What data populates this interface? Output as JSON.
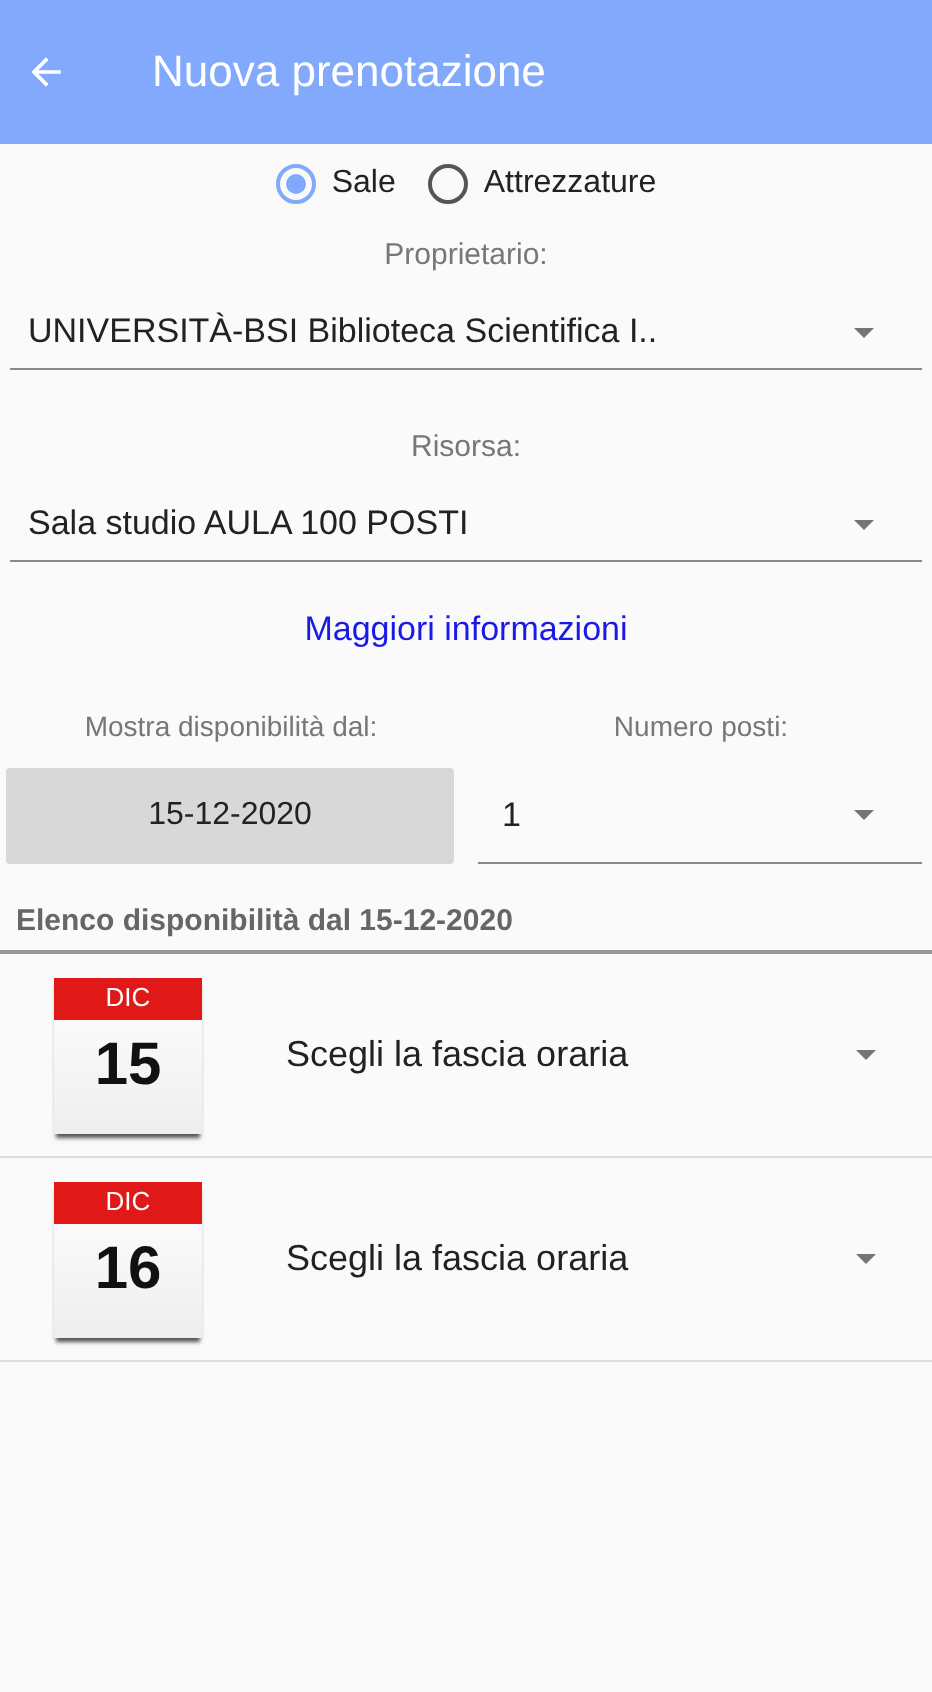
{
  "app_bar": {
    "title": "Nuova prenotazione"
  },
  "resource_type": [
    {
      "label": "Sale",
      "selected": true
    },
    {
      "label": "Attrezzature",
      "selected": false
    }
  ],
  "owner": {
    "label": "Proprietario:",
    "value": "UNIVERSITÀ-BSI Biblioteca Scientifica I.."
  },
  "resource": {
    "label": "Risorsa:",
    "value": "Sala studio AULA 100 POSTI"
  },
  "more_info_link": "Maggiori informazioni",
  "start_date": {
    "label": "Mostra disponibilità dal:",
    "value": "15-12-2020"
  },
  "seats": {
    "label": "Numero posti:",
    "value": "1"
  },
  "availability": {
    "heading": "Elenco disponibilità dal 15-12-2020",
    "days": [
      {
        "month": "DIC",
        "day": "15",
        "slot_placeholder": "Scegli la fascia oraria"
      },
      {
        "month": "DIC",
        "day": "16",
        "slot_placeholder": "Scegli la fascia oraria"
      }
    ]
  }
}
